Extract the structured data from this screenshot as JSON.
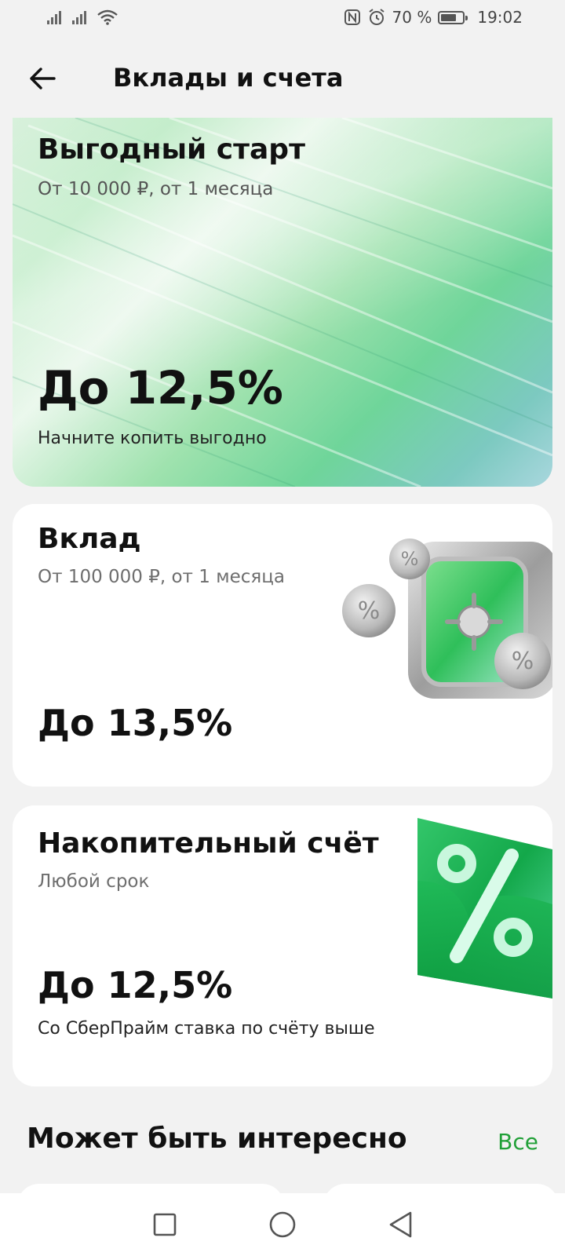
{
  "status_bar": {
    "battery_text": "70 %",
    "time": "19:02",
    "icons": [
      "signal-icon",
      "signal-icon",
      "wifi-icon",
      "nfc-icon",
      "alarm-icon",
      "battery-icon"
    ]
  },
  "header": {
    "title": "Вклады и счета",
    "back_icon": "arrow-left-icon"
  },
  "cards": [
    {
      "title": "Выгодный старт",
      "subtitle": "От 10 000 ₽, от 1 месяца",
      "rate": "До 12,5%",
      "note": "Начните копить выгодно"
    },
    {
      "title": "Вклад",
      "subtitle": "От 100 000 ₽, от 1 месяца",
      "rate": "До 13,5%",
      "illustration": "safe-with-coins-icon"
    },
    {
      "title": "Накопительный счёт",
      "subtitle": "Любой срок",
      "rate": "До 12,5%",
      "note": "Со СберПрайм ставка по счёту выше",
      "illustration": "percent-card-icon"
    }
  ],
  "section": {
    "title": "Может быть интересно",
    "all_link": "Все"
  },
  "nav_bar": {
    "icons": [
      "recents-square-icon",
      "home-circle-icon",
      "back-triangle-icon"
    ]
  },
  "colors": {
    "accent": "#21a038",
    "background": "#f2f2f2",
    "card": "#ffffff"
  }
}
